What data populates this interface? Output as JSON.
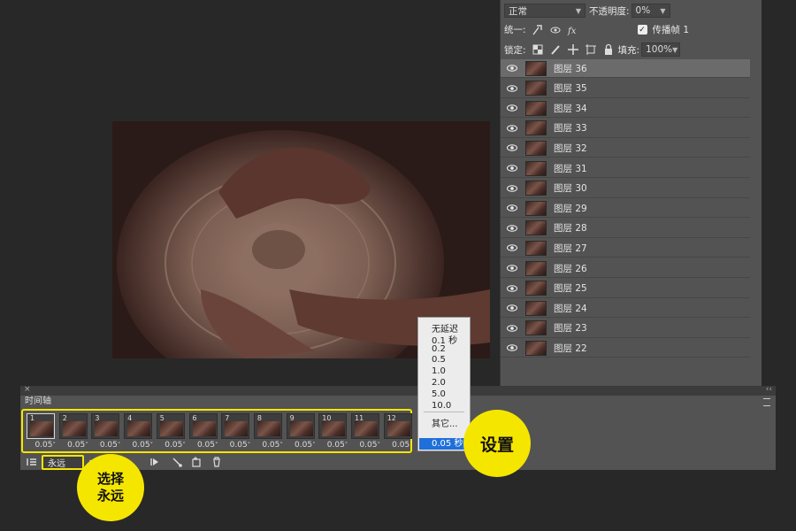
{
  "layers_panel": {
    "blend_mode": "正常",
    "opacity_label": "不透明度:",
    "opacity_value": "0%",
    "unify_label": "统一:",
    "propagate_label": "传播帧 1",
    "propagate_checked": true,
    "lock_label": "锁定:",
    "fill_label": "填充:",
    "fill_value": "100%",
    "layers": [
      "图层 36",
      "图层 35",
      "图层 34",
      "图层 33",
      "图层 32",
      "图层 31",
      "图层 30",
      "图层 29",
      "图层 28",
      "图层 27",
      "图层 26",
      "图层 25",
      "图层 24",
      "图层 23",
      "图层 22"
    ],
    "selected_layer": "图层 36"
  },
  "timeline": {
    "tab_label": "时间轴",
    "frames": [
      {
        "num": "1",
        "delay": "0.05"
      },
      {
        "num": "2",
        "delay": "0.05"
      },
      {
        "num": "3",
        "delay": "0.05"
      },
      {
        "num": "4",
        "delay": "0.05"
      },
      {
        "num": "5",
        "delay": "0.05"
      },
      {
        "num": "6",
        "delay": "0.05"
      },
      {
        "num": "7",
        "delay": "0.05"
      },
      {
        "num": "8",
        "delay": "0.05"
      },
      {
        "num": "9",
        "delay": "0.05"
      },
      {
        "num": "10",
        "delay": "0.05"
      },
      {
        "num": "11",
        "delay": "0.05"
      },
      {
        "num": "12",
        "delay": "0.05"
      }
    ],
    "delay_suffix": "˅",
    "loop_value": "永远"
  },
  "delay_menu": {
    "items": [
      "无延迟",
      "0.1 秒",
      "0.2",
      "0.5",
      "1.0",
      "2.0",
      "5.0",
      "10.0"
    ],
    "other": "其它...",
    "selected": "0.05 秒"
  },
  "callouts": {
    "set": "设置",
    "loop_line1": "选择",
    "loop_line2": "永远"
  },
  "colors": {
    "highlight": "#f5e600",
    "panel": "#535353",
    "background": "#282828",
    "menu_selected": "#1e6fd9"
  }
}
